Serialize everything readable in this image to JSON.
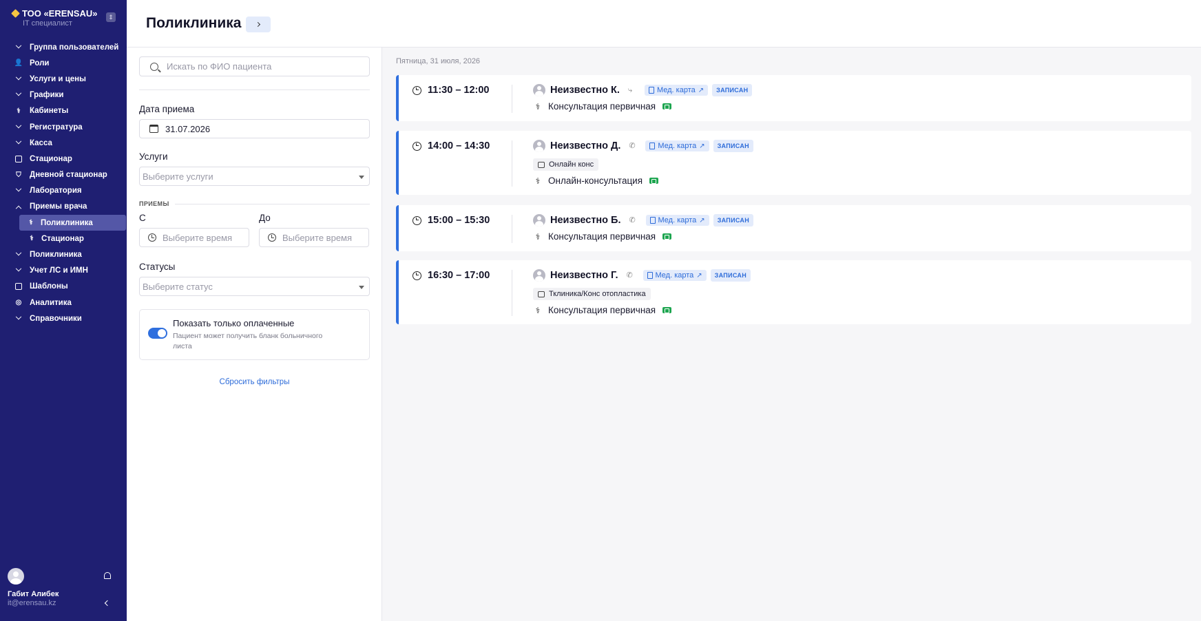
{
  "org": {
    "name": "ТОО «ERENSAU»",
    "role": "IT специалист"
  },
  "nav": [
    {
      "label": "Группа пользователей",
      "icon": "chevron-down"
    },
    {
      "label": "Роли",
      "icon": "users"
    },
    {
      "label": "Услуги и цены",
      "icon": "chevron-down"
    },
    {
      "label": "Графики",
      "icon": "chevron-down"
    },
    {
      "label": "Кабинеты",
      "icon": "stethoscope"
    },
    {
      "label": "Регистратура",
      "icon": "chevron-down"
    },
    {
      "label": "Касса",
      "icon": "chevron-down"
    },
    {
      "label": "Стационар",
      "icon": "document"
    },
    {
      "label": "Дневной стационар",
      "icon": "bed"
    },
    {
      "label": "Лаборатория",
      "icon": "chevron-down"
    },
    {
      "label": "Приемы врача",
      "icon": "chevron-up"
    }
  ],
  "nav_sub": [
    {
      "label": "Поликлиника",
      "active": true
    },
    {
      "label": "Стационар",
      "active": false
    }
  ],
  "nav_after": [
    {
      "label": "Поликлиника",
      "icon": "chevron-down"
    },
    {
      "label": "Учет ЛС и ИМН",
      "icon": "chevron-down"
    },
    {
      "label": "Шаблоны",
      "icon": "folder"
    },
    {
      "label": "Аналитика",
      "icon": "analytics"
    },
    {
      "label": "Справочники",
      "icon": "chevron-down"
    }
  ],
  "user": {
    "name": "Габит Алибек",
    "email": "it@erensau.kz"
  },
  "header": {
    "title": "Поликлиника"
  },
  "filters": {
    "search_placeholder": "Искать по ФИО пациента",
    "date_label": "Дата приема",
    "date_value": "31.07.2026",
    "services_label": "Услуги",
    "services_placeholder": "Выберите услуги",
    "appointments_caption": "ПРИЕМЫ",
    "from_label": "С",
    "to_label": "До",
    "time_placeholder": "Выберите время",
    "status_label": "Статусы",
    "status_placeholder": "Выберите статус",
    "paid_only_title": "Показать только оплаченные",
    "paid_only_desc": "Пациент может получить бланк больничного листа",
    "paid_only_on": true,
    "reset": "Сбросить фильтры"
  },
  "schedule": {
    "day": "Пятница, 31 июля, 2026",
    "med_card_label": "Мед. карта",
    "appointments": [
      {
        "time": "11:30 – 12:00",
        "patient": "Неизвестно К.",
        "status": "ЗАПИСАН",
        "note": "",
        "service": "Консультация первичная",
        "contact_icon": "route"
      },
      {
        "time": "14:00 – 14:30",
        "patient": "Неизвестно Д.",
        "status": "ЗАПИСАН",
        "note": "Онлайн конс",
        "service": "Онлайн-консультация",
        "contact_icon": "phone"
      },
      {
        "time": "15:00 – 15:30",
        "patient": "Неизвестно Б.",
        "status": "ЗАПИСАН",
        "note": "",
        "service": "Консультация первичная",
        "contact_icon": "phone"
      },
      {
        "time": "16:30 – 17:00",
        "patient": "Неизвестно Г.",
        "status": "ЗАПИСАН",
        "note": "Тклиника/Конс отопластика",
        "service": "Консультация первичная",
        "contact_icon": "phone"
      }
    ]
  }
}
